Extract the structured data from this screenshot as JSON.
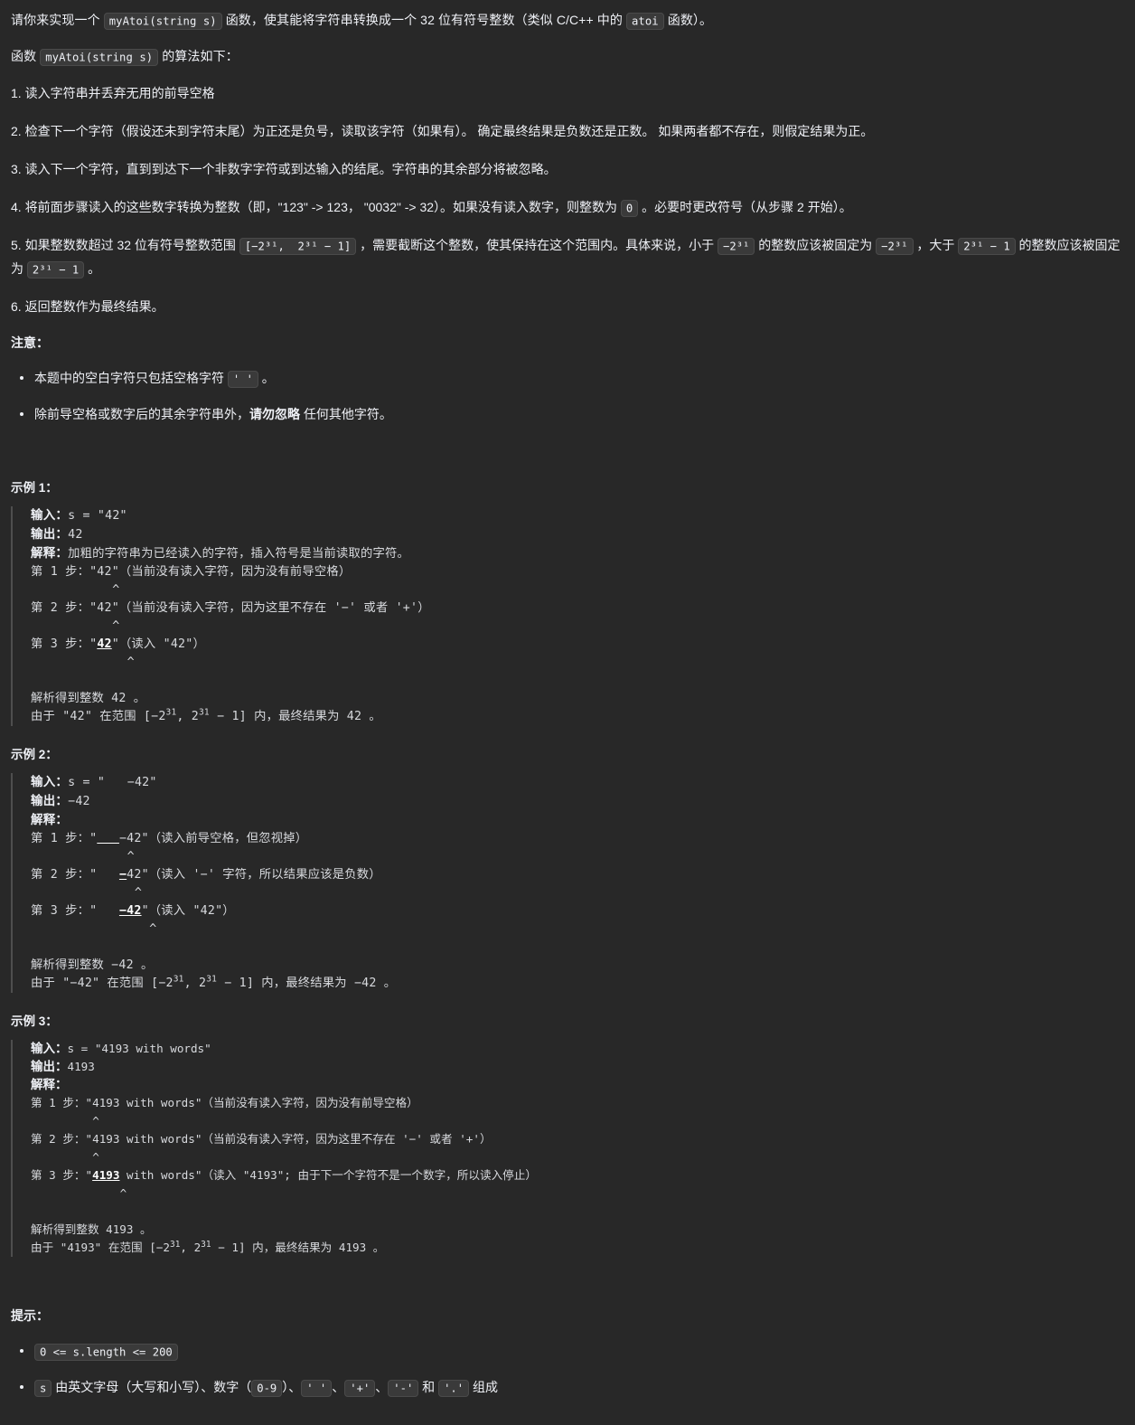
{
  "meta": {
    "background_color": "#282828",
    "text_color": "#eff1f6",
    "chip_background": "#3a3a3a",
    "chip_border": "#4a4a4a",
    "blockquote_border": "#4e4e4e"
  },
  "intro": {
    "lead_before": "请你来实现一个 ",
    "chip_signature": "myAtoi(string s)",
    "lead_middle": " 函数，使其能将字符串转换成一个 32 位有符号整数（类似 C/C++ 中的 ",
    "chip_atoi": "atoi",
    "lead_after": " 函数）。",
    "algo_before": "函数 ",
    "algo_chip": "myAtoi(string s)",
    "algo_after": " 的算法如下："
  },
  "steps": [
    {
      "num": "1. ",
      "text": "读入字符串并丢弃无用的前导空格"
    },
    {
      "num": "2. ",
      "text": "检查下一个字符（假设还未到字符末尾）为正还是负号，读取该字符（如果有）。 确定最终结果是负数还是正数。 如果两者都不存在，则假定结果为正。"
    },
    {
      "num": "3. ",
      "text": "读入下一个字符，直到到达下一个非数字字符或到达输入的结尾。字符串的其余部分将被忽略。"
    },
    {
      "num": "4. ",
      "text_a": "将前面步骤读入的这些数字转换为整数（即，\"123\" -> 123， \"0032\" -> 32）。如果没有读入数字，则整数为 ",
      "chip": "0",
      "text_b": " 。必要时更改符号（从步骤 2 开始）。"
    },
    {
      "num": "5. ",
      "text_a": "如果整数数超过 32 位有符号整数范围 ",
      "chip_range": "[−2³¹,  2³¹ − 1]",
      "text_b": " ，需要截断这个整数，使其保持在这个范围内。具体来说，小于 ",
      "chip_min": "−2³¹",
      "text_c": " 的整数应该被固定为 ",
      "chip_min2": "−2³¹",
      "text_d": " ，大于 ",
      "chip_max": "2³¹ − 1",
      "text_e": " 的整数应该被固定为 ",
      "chip_max2": "2³¹ − 1",
      "text_f": " 。"
    },
    {
      "num": "6. ",
      "text": "返回整数作为最终结果。"
    }
  ],
  "notes": {
    "title": "注意：",
    "items": [
      {
        "text_a": "本题中的空白字符只包括空格字符 ",
        "chip": "' '",
        "text_b": " 。"
      },
      {
        "text_a": "除前导空格或数字后的其余字符串外，",
        "bold": "请勿忽略",
        "text_b": " 任何其他字符。"
      }
    ]
  },
  "examples": [
    {
      "title": "示例 1：",
      "label_input": "输入：",
      "input_value": "s = \"42\"",
      "label_output": "输出：",
      "output_value": "42",
      "label_explain": "解释：",
      "explain_value": "加粗的字符串为已经读入的字符，插入符号是当前读取的字符。",
      "lines": [
        "第 1 步：\"42\"（当前没有读入字符，因为没有前导空格）",
        "           ^",
        "第 2 步：\"42\"（当前没有读入字符，因为这里不存在 '−' 或者 '+'）",
        "           ^",
        "第 3 步：\"42\"（读入 \"42\"）",
        "             ^"
      ],
      "underline_line_index": 4,
      "underline_text": "42",
      "footer_a": "解析得到整数 42 。",
      "footer_b": "由于 \"42\" 在范围 [−2³¹, 2³¹ − 1] 内，最终结果为 42 。"
    },
    {
      "title": "示例 2：",
      "label_input": "输入：",
      "input_value": "s = \"   −42\"",
      "label_output": "输出：",
      "output_value": "−42",
      "label_explain": "解释：",
      "explain_value": "",
      "lines": [
        "第 1 步：\"___−42\"（读入前导空格，但忽视掉）",
        "             ^",
        "第 2 步：\"   −42\"（读入 '−' 字符，所以结果应该是负数）",
        "              ^",
        "第 3 步：\"   −42\"（读入 \"42\"）",
        "                ^"
      ],
      "footer_a": "解析得到整数 −42 。",
      "footer_b": "由于 \"−42\" 在范围 [−2³¹, 2³¹ − 1] 内，最终结果为 −42 。"
    },
    {
      "title": "示例 3：",
      "label_input": "输入：",
      "input_value": "s = \"4193 with words\"",
      "label_output": "输出：",
      "output_value": "4193",
      "label_explain": "解释：",
      "explain_value": "",
      "lines": [
        "第 1 步：\"4193 with words\"（当前没有读入字符，因为没有前导空格）",
        "         ^",
        "第 2 步：\"4193 with words\"（当前没有读入字符，因为这里不存在 '−' 或者 '+'）",
        "         ^",
        "第 3 步：\"4193 with words\"（读入 \"4193\"; 由于下一个字符不是一个数字，所以读入停止）",
        "             ^"
      ],
      "footer_a": "解析得到整数 4193 。",
      "footer_b": "由于 \"4193\" 在范围 [−2³¹, 2³¹ − 1] 内，最终结果为 4193 。"
    }
  ],
  "hints": {
    "title": "提示：",
    "items": [
      {
        "chip_only": "0 <= s.length <= 200"
      },
      {
        "chip_s": "s",
        "text_a": " 由英文字母（大写和小写）、数字（",
        "chip_digits": "0-9",
        "text_b": "）、",
        "chip_space": "' '",
        "text_c": "、",
        "chip_plus": "'+'",
        "text_d": "、",
        "chip_minus": "'-'",
        "text_e": " 和 ",
        "chip_dot": "'.'",
        "text_f": " 组成"
      }
    ]
  }
}
